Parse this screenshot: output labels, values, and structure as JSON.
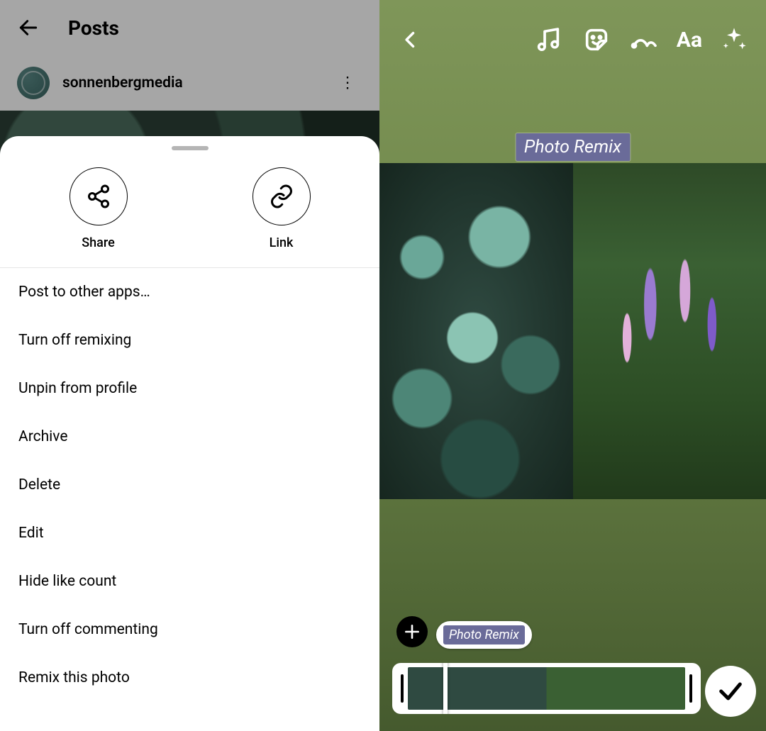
{
  "left": {
    "header": {
      "title": "Posts"
    },
    "user": {
      "name": "sonnenbergmedia"
    },
    "sheet": {
      "actions": {
        "share": "Share",
        "link": "Link"
      },
      "menu": [
        "Post to other apps…",
        "Turn off remixing",
        "Unpin from profile",
        "Archive",
        "Delete",
        "Edit",
        "Hide like count",
        "Turn off commenting",
        "Remix this photo"
      ]
    }
  },
  "right": {
    "toolbar": {
      "text_tool": "Aa"
    },
    "remix_tag": "Photo Remix",
    "pill_label": "Photo Remix"
  }
}
